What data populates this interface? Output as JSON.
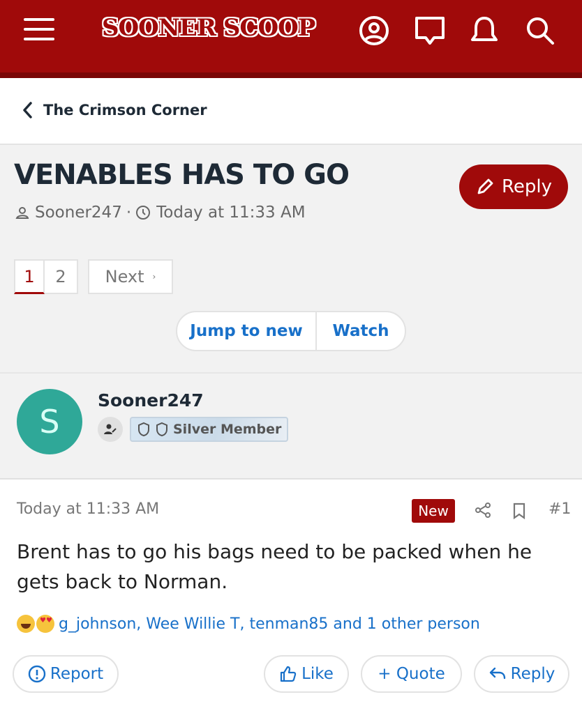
{
  "header": {
    "logo": "SOONER SCOOP",
    "icons": [
      "menu-icon",
      "account-icon",
      "conversations-icon",
      "alerts-icon",
      "search-icon"
    ],
    "bg_color": "#a00a0a"
  },
  "breadcrumb": {
    "label": "The Crimson Corner"
  },
  "thread": {
    "title": "VENABLES HAS TO GO",
    "reply_label": "Reply",
    "author": "Sooner247",
    "separator": "·",
    "time": "Today at 11:33 AM"
  },
  "pagination": {
    "page1": "1",
    "page2": "2",
    "next_label": "Next",
    "next_arrow": "›",
    "current_page": 1
  },
  "actions": {
    "jump_label": "Jump to new",
    "watch_label": "Watch"
  },
  "user": {
    "avatar_letter": "S",
    "name": "Sooner247",
    "badge": "Silver Member",
    "avatar_color": "#2fa898"
  },
  "post": {
    "time": "Today at 11:33 AM",
    "new_badge": "New",
    "number": "#1",
    "text": "Brent has to go his bags need to be packed when he gets back to Norman.",
    "reactions": "g_johnson, Wee Willie T, tenman85 and 1 other person",
    "report_label": "Report",
    "like_label": "Like",
    "quote_label": "+ Quote",
    "reply_label": "Reply"
  },
  "colors": {
    "accent": "#a00a0a",
    "link": "#1870c9"
  }
}
